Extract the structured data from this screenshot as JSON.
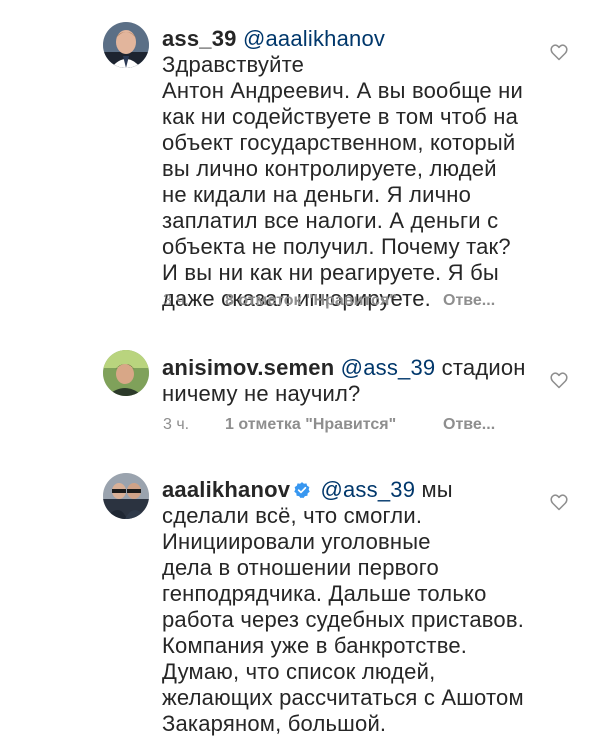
{
  "comments": [
    {
      "username": "ass_39",
      "mention": "@aaalikhanov",
      "lines": [
        " Здравствуйте",
        "Антон Андреевич. А вы вообще ни",
        "как ни содействуете в том чтоб на",
        "объект государственном, который",
        "вы лично контролируете, людей",
        "не кидали на деньги. Я лично",
        "заплатил все налоги. А деньги с",
        "объекта не получил. Почему так?",
        "И вы ни как ни реагируете. Я бы",
        "даже сказал игнорируете."
      ],
      "time": "3 ч.",
      "likes": "8 отметок \"Нравится\"",
      "reply": "Отве..."
    },
    {
      "username": "anisimov.semen",
      "mention": "@ass_39",
      "lines": [
        " стадион",
        "ничему не научил?"
      ],
      "time": "3 ч.",
      "likes": "1 отметка \"Нравится\"",
      "reply": "Отве..."
    },
    {
      "username": "aaalikhanov",
      "verified": true,
      "mention": "@ass_39",
      "lines": [
        " мы",
        "сделали всё, что смогли.",
        "Инициировали уголовные",
        "дела в отношении первого",
        "генподрядчика. Дальше только",
        "работа через судебных приставов.",
        "Компания уже в банкротстве.",
        "Думаю, что список людей,",
        "желающих рассчитаться с Ашотом",
        "Закаряном, большой."
      ]
    }
  ],
  "icons": {
    "like": "heart-outline-icon",
    "verified": "verified-badge-icon"
  },
  "colors": {
    "text": "#262626",
    "secondary": "#8e8e8e",
    "mention": "#00376b",
    "verified": "#3897f0"
  }
}
